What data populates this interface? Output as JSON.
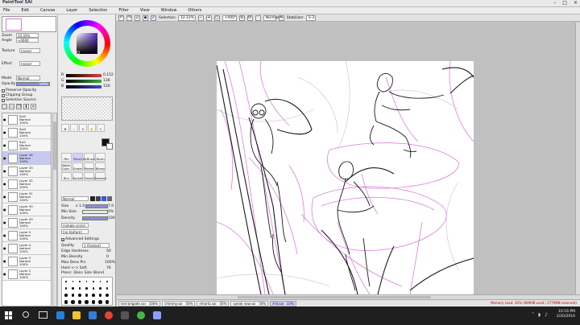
{
  "app": {
    "logo_text": "PaintTool SAI",
    "window_controls": [
      "–",
      "□",
      "×"
    ]
  },
  "menu": [
    "File",
    "Edit",
    "Canvas",
    "Layer",
    "Selection",
    "Filter",
    "View",
    "Window",
    "Others"
  ],
  "toolbar": {
    "selection_label": "Selection",
    "zoom_value": "33.33%",
    "rotation_value": "+000°",
    "mode_value": "Normal",
    "stabilizer_label": "Stabilizer",
    "stabilizer_value": "S-3"
  },
  "navigator": {
    "zoom_label": "Zoom",
    "zoom_value": "33.33%",
    "angle_label": "Angle",
    "angle_value": "+0000"
  },
  "layer_panel": {
    "texture_label": "Texture",
    "texture_value": "(none)",
    "effect_label": "Effect",
    "effect_value": "(none)",
    "mode_label": "Mode",
    "mode_value": "Normal",
    "opacity_label": "Opacity",
    "opacity_value": "100%",
    "preserve_opacity": "Preserve Opacity",
    "clipping_group": "Clipping Group",
    "selection_source": "Selection Source",
    "layers": [
      {
        "name": "Sai2",
        "mode": "Normal",
        "opacity": "100%",
        "selected": false
      },
      {
        "name": "Sai3",
        "mode": "Normal",
        "opacity": "100%",
        "selected": false
      },
      {
        "name": "Sai1",
        "mode": "Normal",
        "opacity": "100%",
        "selected": false
      },
      {
        "name": "Layer 34",
        "mode": "Normal",
        "opacity": "100%",
        "selected": true
      },
      {
        "name": "Layer 33",
        "mode": "Normal",
        "opacity": "100%",
        "selected": false
      },
      {
        "name": "Layer 32",
        "mode": "Normal",
        "opacity": "100%",
        "selected": false
      },
      {
        "name": "Layer 31",
        "mode": "Normal",
        "opacity": "100%",
        "selected": false
      },
      {
        "name": "Layer 30",
        "mode": "Normal",
        "opacity": "100%",
        "selected": false
      },
      {
        "name": "Layer 29",
        "mode": "Normal",
        "opacity": "100%",
        "selected": false
      },
      {
        "name": "Layer 5",
        "mode": "Normal",
        "opacity": "100%",
        "selected": false
      },
      {
        "name": "Layer 4",
        "mode": "Normal",
        "opacity": "100%",
        "selected": false
      },
      {
        "name": "Layer 3",
        "mode": "Normal",
        "opacity": "100%",
        "selected": false
      },
      {
        "name": "Layer 2",
        "mode": "Normal",
        "opacity": "100%",
        "selected": false
      }
    ]
  },
  "color": {
    "sliders": [
      {
        "label": "R",
        "value": "0.152"
      },
      {
        "label": "G",
        "value": "136"
      },
      {
        "label": "B",
        "value": "150"
      }
    ],
    "current": "#111111",
    "secondary": "#ffffff"
  },
  "tools": [
    "Pen",
    "Pencil",
    "AirBrush",
    "Brush",
    "Water Color",
    "Eraser",
    "Marker",
    "Binary",
    "Blur",
    "Bucket",
    "Select",
    "Deselect"
  ],
  "brush": {
    "mode_value": "Normal",
    "size_label": "Size",
    "size_multiplier": "x 1.0",
    "size_value": "7.0",
    "min_size_label": "Min Size",
    "min_size_value": "0%",
    "density_label": "Density",
    "density_value": "100",
    "shape_value": "(simple circle)",
    "texture_value": "(no texture)",
    "advanced_label": "Advanced Settings",
    "quality_label": "Quality",
    "quality_value": "1 (Fastest)",
    "edge_label": "Edge Hardness",
    "edge_value": "50",
    "min_density_label": "Min Density",
    "min_density_value": "0",
    "max_dens_prs_label": "Max Dens Prs",
    "max_dens_prs_value": "100%",
    "hard_soft_label": "Hard <-> Soft",
    "hard_soft_value": "76",
    "press_label": "Press:",
    "dens_label": "Dens",
    "size_cb_label": "Size",
    "blend_label": "Blend"
  },
  "documents": [
    {
      "name": "lost brigade.sai",
      "zoom": "100%",
      "active": false
    },
    {
      "name": "chimmy.sai",
      "zoom": "50%",
      "active": false
    },
    {
      "name": "mhartz.sai",
      "zoom": "50%",
      "active": false
    },
    {
      "name": "speak now.sai",
      "zoom": "50%",
      "active": false
    },
    {
      "name": "A B.sai",
      "zoom": "33%",
      "active": true
    }
  ],
  "status": {
    "memory": "Memory Load: 34% (989MB used / 2779MB reserved)"
  },
  "taskbar": {
    "time": "10:16 PM",
    "date": "2/20/2016"
  }
}
